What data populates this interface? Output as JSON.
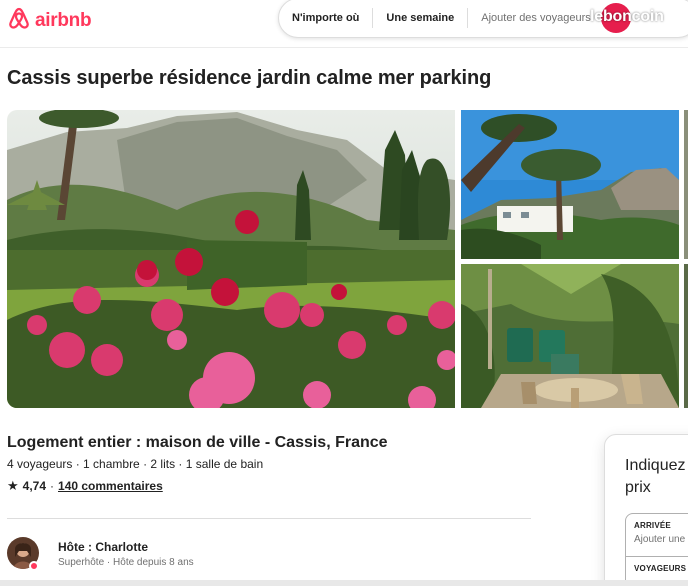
{
  "header": {
    "brand": "airbnb",
    "search": {
      "location": "N'importe où",
      "dates": "Une semaine",
      "guests_placeholder": "Ajouter des voyageurs"
    },
    "watermark": "leboncoin"
  },
  "listing": {
    "title": "Cassis superbe résidence jardin calme mer parking",
    "subtitle": "Logement entier : maison de ville - Cassis, France",
    "details": "4 voyageurs · 1 chambre · 2 lits · 1 salle de bain",
    "rating": "4,74",
    "rating_separator": "·",
    "reviews": "140 commentaires"
  },
  "host": {
    "name": "Hôte : Charlotte",
    "subtitle": "Superhôte · Hôte depuis 8 ans"
  },
  "booking": {
    "title": "Indiquez les prix",
    "arrival_label": "ARRIVÉE",
    "arrival_placeholder": "Ajouter une",
    "guests_label": "VOYAGEURS"
  },
  "colors": {
    "brand": "#ff385c",
    "search_button": "#e61e4d"
  },
  "icons": {
    "logo": "airbnb-logo-icon",
    "rating": "star-icon",
    "search": "search-icon"
  }
}
